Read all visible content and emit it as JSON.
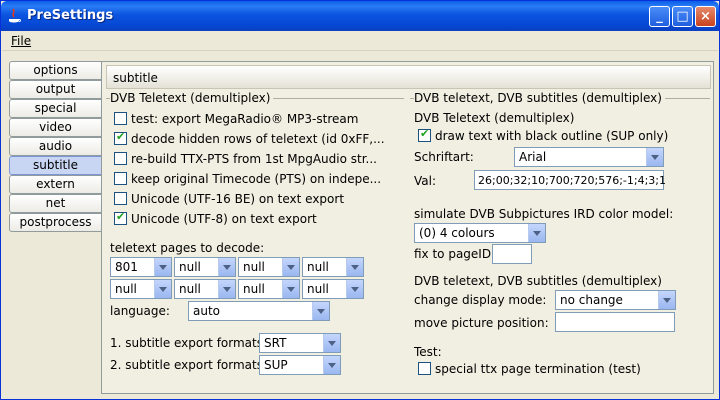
{
  "window": {
    "title": "PreSettings",
    "minimize": "_",
    "maximize": "□",
    "close": "×"
  },
  "menu": {
    "file": "File"
  },
  "tabs": [
    "options",
    "output",
    "special",
    "video",
    "audio",
    "subtitle",
    "extern",
    "net",
    "postprocess"
  ],
  "selected_tab": "subtitle",
  "panel": {
    "header": "subtitle",
    "left_group": {
      "title": "DVB Teletext (demultiplex)",
      "checkboxes": [
        {
          "label": "test: export MegaRadio® MP3-stream",
          "checked": false
        },
        {
          "label": "decode hidden rows of teletext (id 0xFF,...",
          "checked": true
        },
        {
          "label": "re-build TTX-PTS from 1st MpgAudio str...",
          "checked": false
        },
        {
          "label": "keep original Timecode (PTS) on indepe...",
          "checked": false
        },
        {
          "label": "Unicode (UTF-16 BE) on text export",
          "checked": false
        },
        {
          "label": "Unicode (UTF-8) on text export",
          "checked": true
        }
      ],
      "pages_label": "teletext pages to decode:",
      "pages": [
        "801",
        "null",
        "null",
        "null",
        "null",
        "null",
        "null",
        "null"
      ],
      "language_label": "language:",
      "language": "auto",
      "export1_label": "1. subtitle export formats:",
      "export1": "SRT",
      "export2_label": "2. subtitle export formats:",
      "export2": "SUP"
    },
    "right_group": {
      "title": "DVB teletext, DVB subtitles (demultiplex)",
      "sub_title": "DVB Teletext (demultiplex)",
      "outline_label": "draw text with black outline (SUP only)",
      "outline_checked": true,
      "font_label": "Schriftart:",
      "font_value": "Arial",
      "val_label": "Val:",
      "val_value": "26;00;32;10;700;720;576;-1;4;3;1",
      "ird_label": "simulate DVB Subpictures IRD color model:",
      "ird_value": "(0) 4 colours",
      "pageid_label": "fix to pageID:",
      "pageid_value": "",
      "display_group": "DVB teletext, DVB subtitles (demultiplex)",
      "display_mode_label": "change display mode:",
      "display_mode_value": "no change",
      "move_label": "move picture position:",
      "move_value": "",
      "test_label": "Test:",
      "ttx_label": "special ttx page termination (test)",
      "ttx_checked": false
    }
  }
}
